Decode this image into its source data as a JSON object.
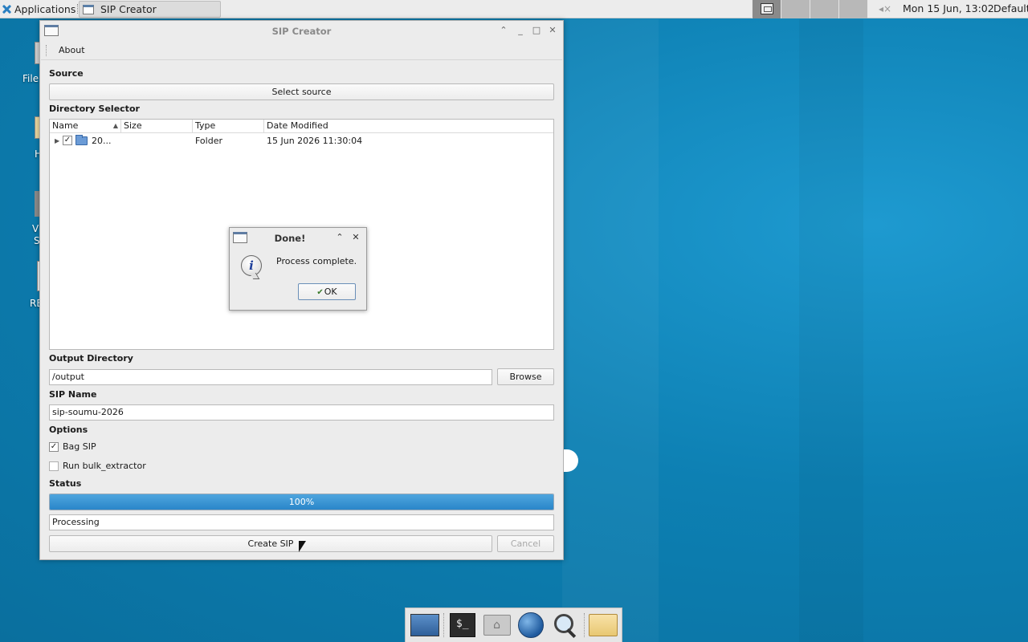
{
  "top_panel": {
    "applications_label": "Applications",
    "task_title": "SIP Creator",
    "clock": "Mon 15 Jun, 13:02",
    "layout": "Default"
  },
  "desktop": {
    "labels": [
      "File",
      "H",
      "V",
      "S",
      "RE"
    ]
  },
  "window": {
    "title": "SIP Creator",
    "menu": {
      "about": "About"
    },
    "source": {
      "label": "Source",
      "select_button": "Select source"
    },
    "directory": {
      "label": "Directory Selector",
      "columns": [
        "Name",
        "Size",
        "Type",
        "Date Modified"
      ],
      "rows": [
        {
          "name": "20...",
          "size": "",
          "type": "Folder",
          "date_modified": "15 Jun 2026 11:30:04",
          "checked": true
        }
      ]
    },
    "output": {
      "label": "Output Directory",
      "value": "/output",
      "browse_button": "Browse"
    },
    "sip_name": {
      "label": "SIP Name",
      "value": "sip-soumu-2026"
    },
    "options": {
      "label": "Options",
      "bag_sip": {
        "label": "Bag SIP",
        "checked": true
      },
      "bulk_extractor": {
        "label": "Run bulk_extractor",
        "checked": false
      }
    },
    "status": {
      "label": "Status",
      "progress_percent": 100,
      "progress_text": "100%",
      "status_text": "Processing"
    },
    "buttons": {
      "create": "Create SIP",
      "cancel": "Cancel"
    }
  },
  "dialog": {
    "title": "Done!",
    "message": "Process complete.",
    "ok_button": "OK"
  },
  "colors": {
    "desktop_bg": "#0d80b3",
    "progress_fill": "#2a86c9",
    "panel_bg": "#ececec"
  }
}
